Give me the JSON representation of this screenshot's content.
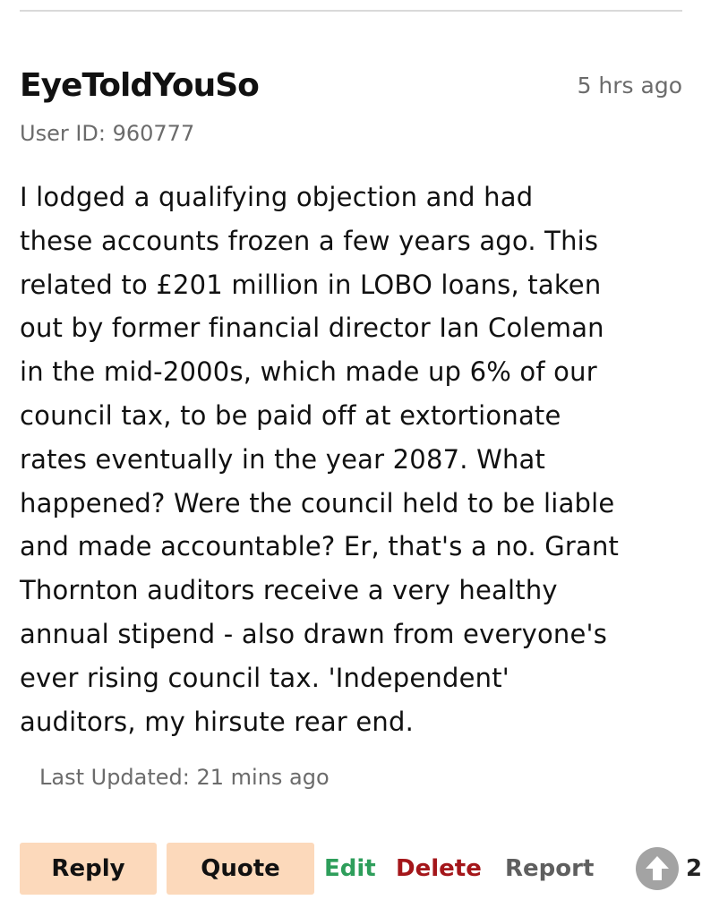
{
  "comment": {
    "username": "EyeToldYouSo",
    "timestamp": "5 hrs ago",
    "user_id": "User ID: 960777",
    "body": "I lodged a qualifying objection and had\nthese accounts frozen a few years ago. This\nrelated to £201 million in LOBO loans, taken\nout by former financial director Ian Coleman\nin the mid-2000s, which made up 6% of our\ncouncil tax, to be paid off at extortionate\nrates eventually in the year 2087. What\nhappened? Were the council held to be liable\nand made accountable? Er, that's a no. Grant\nThornton auditors receive a very healthy\nannual stipend - also drawn from everyone's\never rising council tax. 'Independent'\nauditors, my hirsute rear end.",
    "last_updated": "Last Updated: 21 mins ago"
  },
  "actions": {
    "reply_label": "Reply",
    "quote_label": "Quote",
    "edit_label": "Edit",
    "delete_label": "Delete",
    "report_label": "Report",
    "upvote_icon": "arrow-up-circle-icon",
    "vote_count": "2"
  },
  "colors": {
    "button_background": "#fcd9bb",
    "edit": "#2e9e5b",
    "delete": "#a4161a",
    "report": "#5f5f5f",
    "muted_text": "#6b6b6b",
    "vote_circle": "#a3a3a3"
  }
}
